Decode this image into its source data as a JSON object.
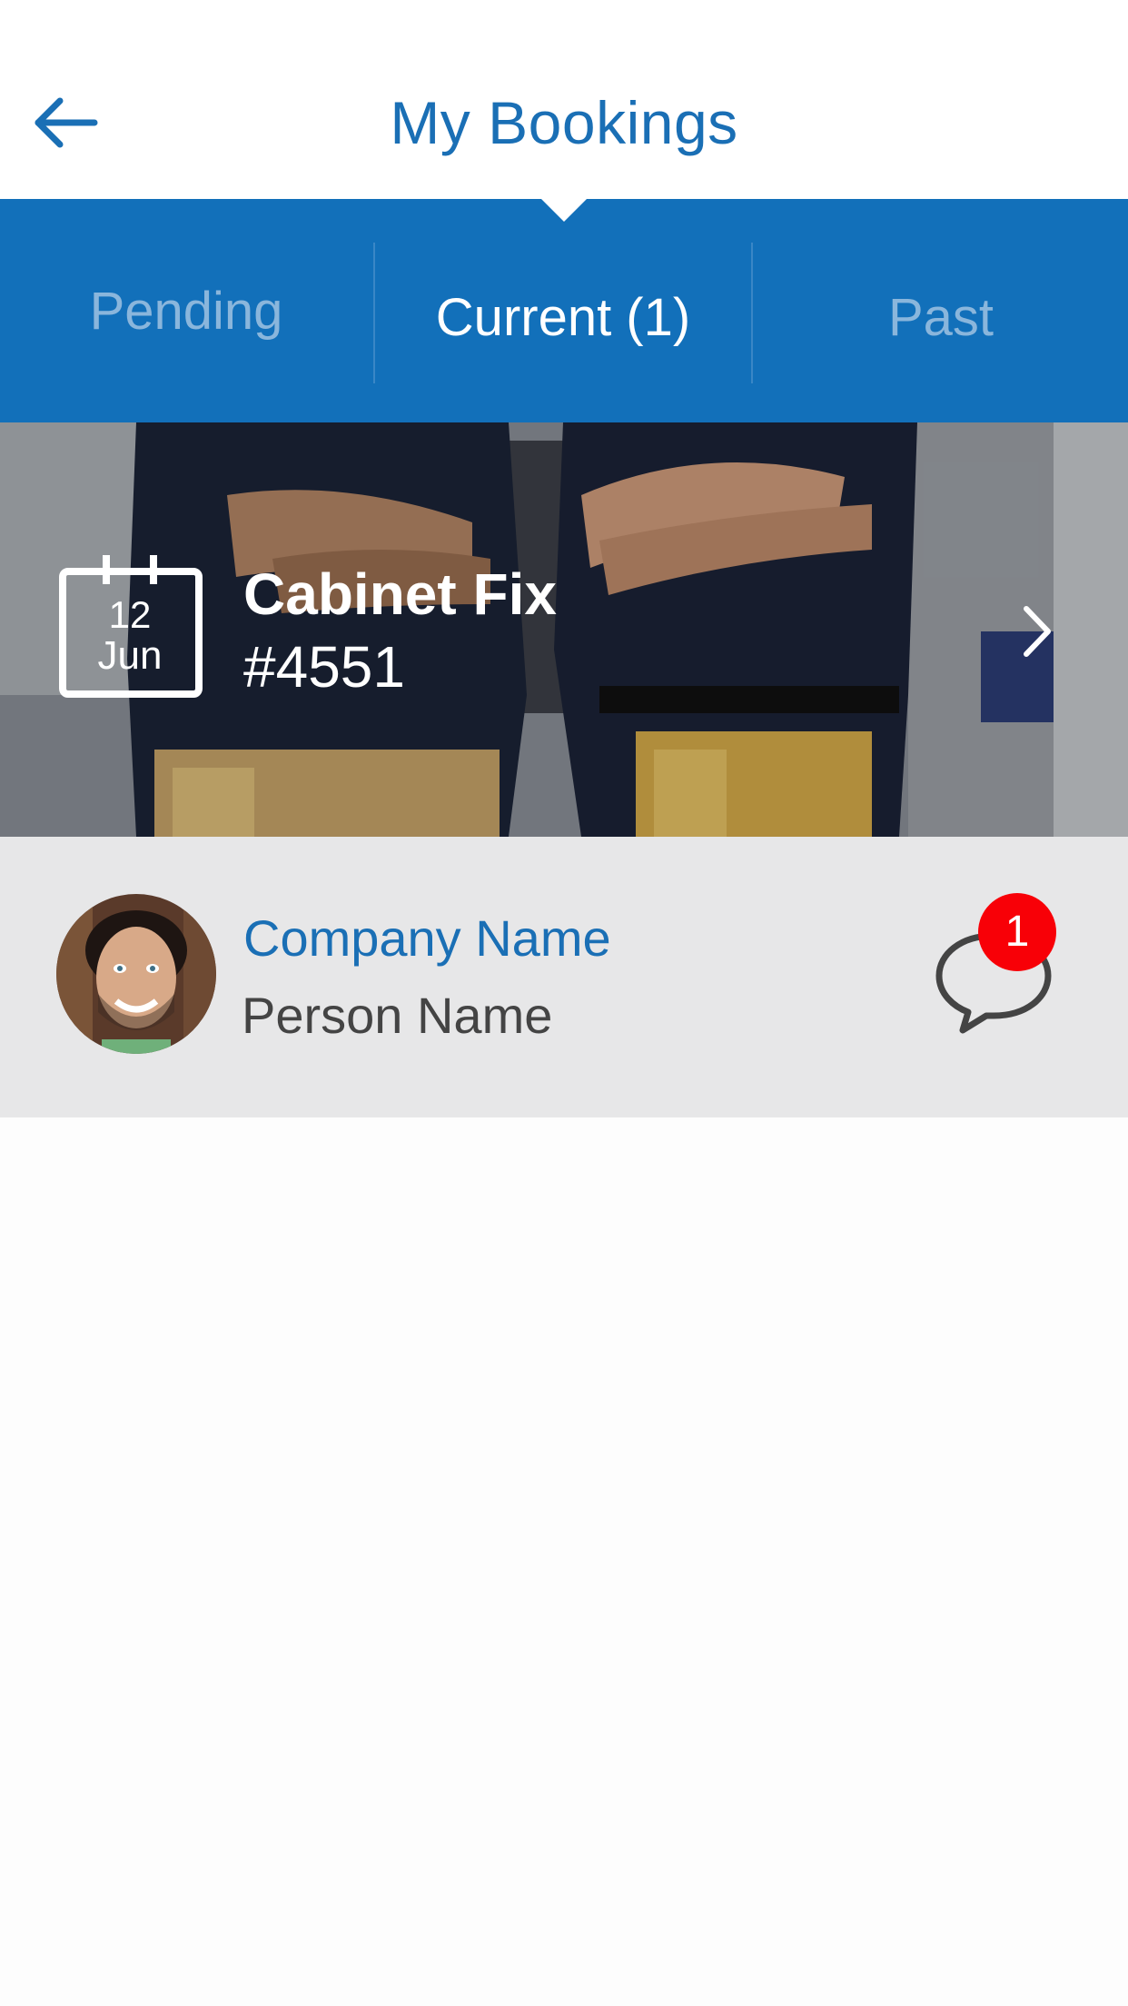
{
  "header": {
    "title": "My Bookings",
    "back_icon": "arrow-left-icon"
  },
  "tabs": [
    {
      "label": "Pending",
      "active": false
    },
    {
      "label": "Current (1)",
      "active": true
    },
    {
      "label": "Past",
      "active": false
    }
  ],
  "booking": {
    "day": "12",
    "month": "Jun",
    "title": "Cabinet Fix",
    "number": "#4551",
    "calendar_icon": "calendar-icon",
    "chevron_icon": "chevron-right-icon"
  },
  "provider": {
    "company_name": "Company Name",
    "person_name": "Person Name",
    "chat_icon": "chat-bubble-icon",
    "unread_count": "1"
  },
  "colors": {
    "brand_blue": "#1270ba",
    "title_blue": "#1a6fb5",
    "inactive_tab": "#8ab6dc",
    "badge_red": "#f80007",
    "provider_bg": "#e7e7e8"
  }
}
